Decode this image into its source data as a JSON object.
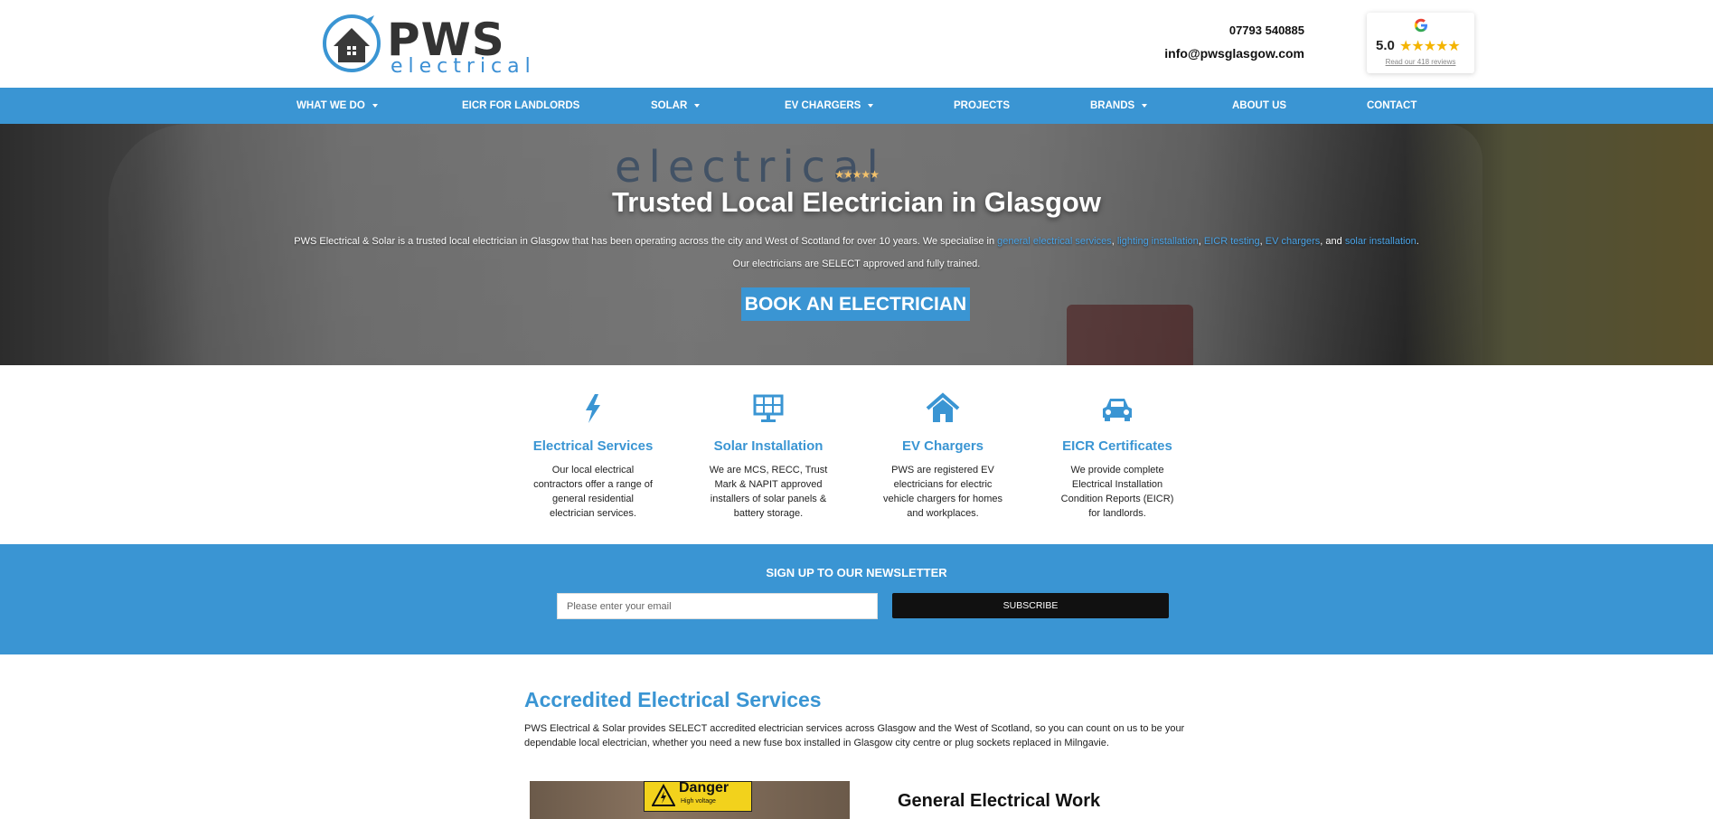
{
  "header": {
    "logo_text": "PWS",
    "logo_sub": "electrical",
    "phone": "07793 540885",
    "email": "info@pwsglasgow.com"
  },
  "rating": {
    "score": "5.0",
    "stars": "★★★★★",
    "reviews_link": "Read our 418 reviews"
  },
  "nav": {
    "items": [
      {
        "label": "WHAT WE DO",
        "dropdown": true
      },
      {
        "label": "EICR FOR LANDLORDS",
        "dropdown": false
      },
      {
        "label": "SOLAR",
        "dropdown": true
      },
      {
        "label": "EV CHARGERS",
        "dropdown": true
      },
      {
        "label": "PROJECTS",
        "dropdown": false
      },
      {
        "label": "BRANDS",
        "dropdown": true
      },
      {
        "label": "ABOUT US",
        "dropdown": false
      },
      {
        "label": "CONTACT",
        "dropdown": false
      }
    ]
  },
  "hero": {
    "stars": "★★★★★",
    "title": "Trusted Local Electrician in Glasgow",
    "desc_part1": "PWS Electrical & Solar is a trusted local electrician in Glasgow that has been operating across the city and West of Scotland for over 10 years. We specialise in ",
    "link_general": "general electrical services",
    "link_lighting": "lighting installation",
    "link_eicr": "EICR testing",
    "link_ev": "EV chargers",
    "and_text": ", and ",
    "link_solar": "solar installation",
    "desc_line2": "Our electricians are SELECT approved and fully trained.",
    "cta": "BOOK AN ELECTRICIAN",
    "ghost_text": "electrical"
  },
  "features": [
    {
      "icon": "lightning-icon",
      "title": "Electrical Services",
      "text": "Our local electrical contractors offer a range of general residential electrician services."
    },
    {
      "icon": "solar-panel-icon",
      "title": "Solar Installation",
      "text": "We are MCS, RECC, Trust Mark & NAPIT approved installers of solar panels & battery storage."
    },
    {
      "icon": "home-icon",
      "title": "EV Chargers",
      "text": "PWS are registered EV electricians for electric vehicle chargers for homes and workplaces."
    },
    {
      "icon": "car-icon",
      "title": "EICR Certificates",
      "text": "We provide complete Electrical Installation Condition Reports (EICR) for landlords."
    }
  ],
  "newsletter": {
    "title": "SIGN UP TO OUR NEWSLETTER",
    "placeholder": "Please enter your email",
    "button": "SUBSCRIBE"
  },
  "accredited": {
    "title": "Accredited Electrical Services",
    "desc": "PWS Electrical & Solar provides SELECT accredited electrician services across Glasgow and the West of Scotland, so you can count on us to be your dependable local electrician, whether you need a new fuse box installed in Glasgow city centre or plug sockets replaced in Milngavie.",
    "sign_title": "Danger",
    "sign_sub": "High voltage",
    "general_title": "General Electrical Work"
  },
  "colors": {
    "brand_blue": "#3a95d3",
    "star_gold": "#f4b400",
    "dark": "#111111"
  }
}
